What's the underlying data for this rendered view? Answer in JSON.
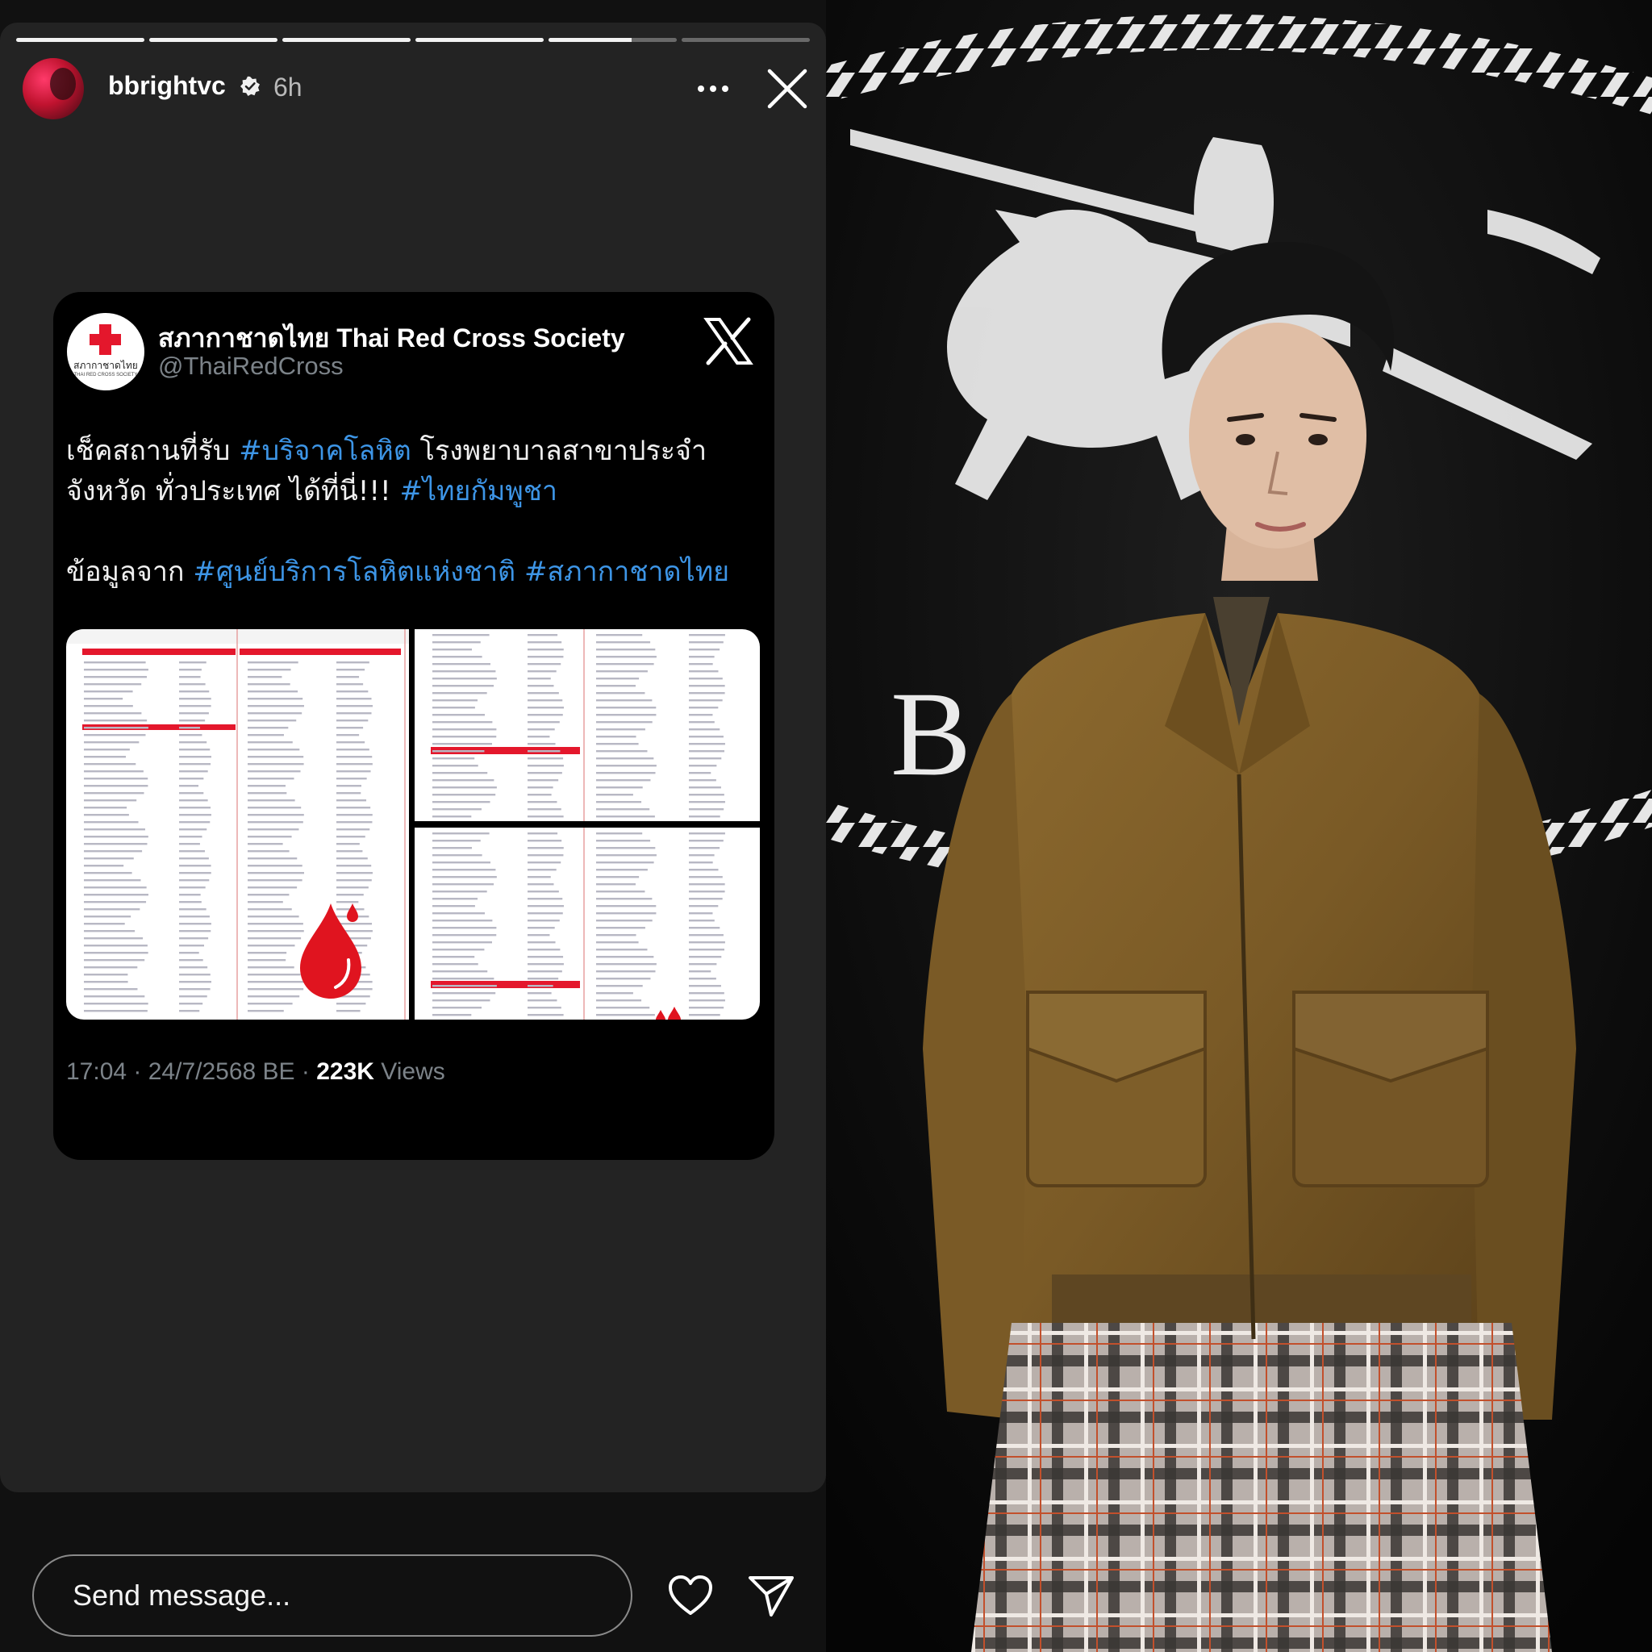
{
  "story": {
    "progress": [
      1,
      1,
      1,
      1,
      0.65,
      0
    ],
    "username": "bbrightvc",
    "verified": true,
    "time_ago": "6h",
    "more_icon": "more-horizontal-icon",
    "close_icon": "close-icon"
  },
  "tweet": {
    "name": "สภากาชาดไทย Thai Red Cross Society",
    "handle": "@ThaiRedCross",
    "logo_text": "สภากาชาดไทย",
    "logo_subtext": "THAI RED CROSS SOCIETY",
    "text": {
      "line1_a": "เช็คสถานที่รับ ",
      "line1_tag": "#บริจาคโลหิต",
      "line1_b": " โรงพยาบาลสาขาประจำ",
      "line2_a": "จังหวัด ทั่วประเทศ ได้ที่นี่!!! ",
      "line2_tag": "#ไทยกัมพูชา",
      "line3_a": "ข้อมูลจาก ",
      "line3_tag1": "#ศูนย์บริการโลหิตแห่งชาติ",
      "line3_sp": " ",
      "line3_tag2": "#สภากาชาดไทย"
    },
    "time": "17:04",
    "sep1": " · ",
    "date": "24/7/2568 BE",
    "sep2": " · ",
    "views_count": "223K",
    "views_label": " Views"
  },
  "footer": {
    "message_placeholder": "Send message...",
    "like_icon": "heart-icon",
    "share_icon": "send-icon"
  },
  "colors": {
    "hashtag": "#3d95e6",
    "red_cross": "#e4172c",
    "story_bg": "#232323",
    "tweet_bg": "#000000"
  }
}
